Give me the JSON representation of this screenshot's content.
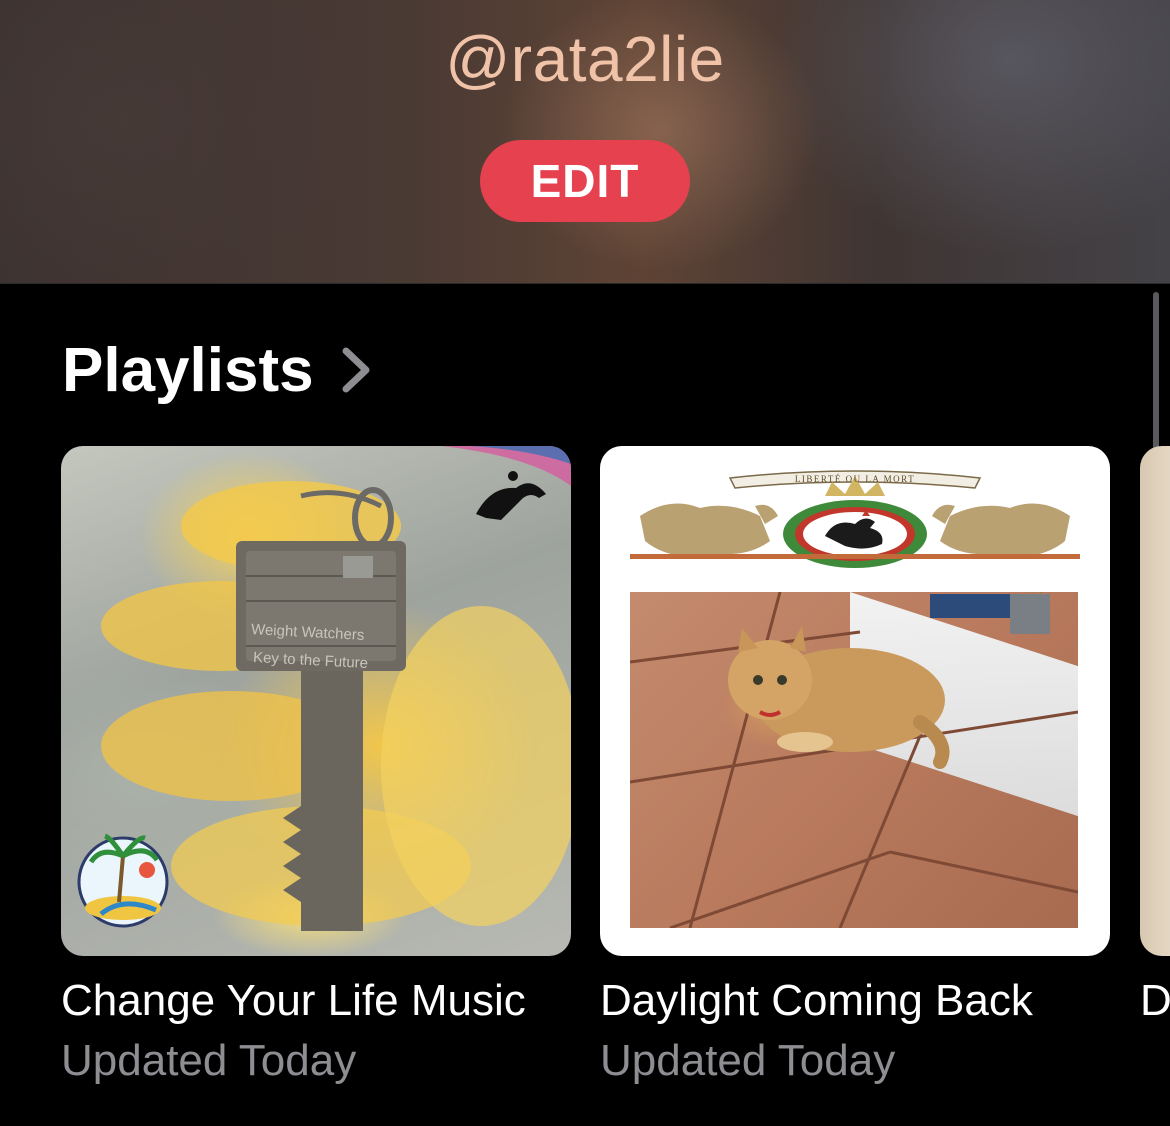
{
  "profile": {
    "handle": "@rata2lie",
    "edit_label": "EDIT"
  },
  "playlists_section": {
    "title": "Playlists",
    "items": [
      {
        "title": "Change Your Life Music",
        "subtitle": "Updated Today",
        "art_text": [
          "Weight Watchers",
          "Key to the Future"
        ]
      },
      {
        "title": "Daylight Coming Back",
        "subtitle": "Updated Today",
        "art_text": [
          "LIBERTÉ OU LA MORT"
        ]
      },
      {
        "title": "D"
      }
    ]
  },
  "colors": {
    "accent": "#e5414f",
    "handle": "#f0c2a8",
    "subtitle": "#8d8d92"
  },
  "icons": {
    "section_chevron": "chevron-right-icon"
  }
}
